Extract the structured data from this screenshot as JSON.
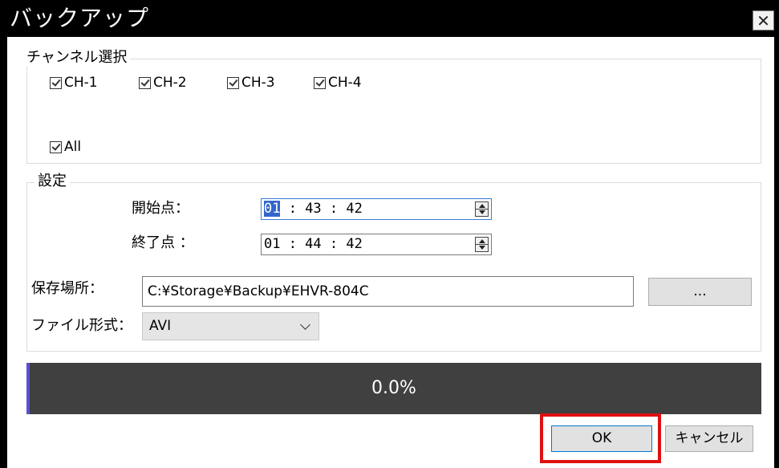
{
  "window": {
    "title": "バックアップ",
    "close_glyph": "✕"
  },
  "channels": {
    "group_title": "チャンネル選択",
    "items": [
      {
        "label": "CH-1",
        "checked": true
      },
      {
        "label": "CH-2",
        "checked": true
      },
      {
        "label": "CH-3",
        "checked": true
      },
      {
        "label": "CH-4",
        "checked": true
      }
    ],
    "all": {
      "label": "All",
      "checked": true
    }
  },
  "settings": {
    "group_title": "設定",
    "start": {
      "label": "開始点：",
      "hh": "01",
      "rest": " : 43 : 42"
    },
    "end": {
      "label": "終了点 ：",
      "value": "01 : 44 : 42"
    },
    "save_location": {
      "label": "保存場所：",
      "value": "C:¥Storage¥Backup¥EHVR-804C",
      "browse_label": "..."
    },
    "file_format": {
      "label": "ファイル形式：",
      "selected": "AVI"
    }
  },
  "progress": {
    "percent": 0.0,
    "text": "0.0%"
  },
  "buttons": {
    "ok": "OK",
    "cancel": "キャンセル"
  },
  "colors": {
    "titlebar": "#000000",
    "progress_bg": "#404040",
    "highlight": "#e01010",
    "selection": "#3366cc"
  }
}
